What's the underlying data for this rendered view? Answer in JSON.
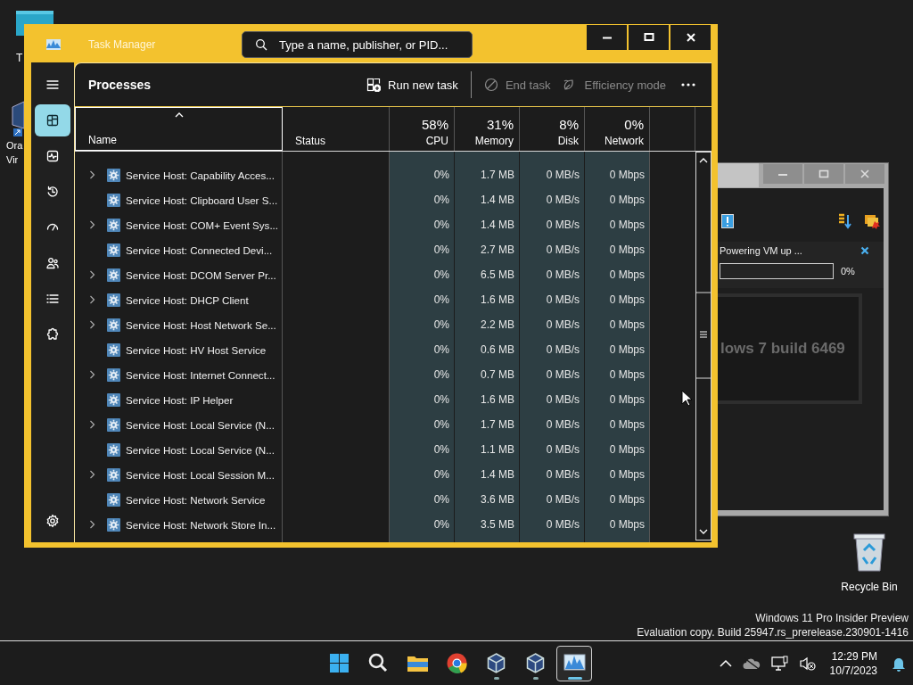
{
  "desktop_icons": [
    {
      "label_lines": [
        "T"
      ]
    },
    {
      "label_lines": [
        "Ora",
        "Vir"
      ]
    }
  ],
  "recycle_bin": {
    "label": "Recycle Bin"
  },
  "vbox_window": {
    "notice": "Powering VM up ...",
    "progress": {
      "level": 0,
      "reading": "0%"
    },
    "preview_text": "lows 7 build 6469"
  },
  "task_manager": {
    "title": "Task Manager",
    "search": {
      "placeholder": "Type a name, publisher, or PID..."
    },
    "nav": [
      {
        "kind": "menu",
        "selected": false
      },
      {
        "kind": "processes",
        "selected": true
      },
      {
        "kind": "performance",
        "selected": false
      },
      {
        "kind": "history",
        "selected": false
      },
      {
        "kind": "startup",
        "selected": false
      },
      {
        "kind": "users",
        "selected": false
      },
      {
        "kind": "details",
        "selected": false
      },
      {
        "kind": "services",
        "selected": false
      },
      {
        "kind": "settings",
        "selected": false
      }
    ],
    "page_title": "Processes",
    "toolbar": [
      {
        "kind": "run",
        "label": "Run new task",
        "disabled": false
      },
      {
        "kind": "end",
        "label": "End task",
        "disabled": true
      },
      {
        "kind": "efficiency",
        "label": "Efficiency mode",
        "disabled": true
      }
    ],
    "columns": [
      {
        "label": "Name",
        "sorted": true
      },
      {
        "label": "Status",
        "sorted": false
      },
      {
        "percent": "58%",
        "label": "CPU",
        "sorted": false
      },
      {
        "percent": "31%",
        "label": "Memory",
        "sorted": false
      },
      {
        "percent": "8%",
        "label": "Disk",
        "sorted": false
      },
      {
        "percent": "0%",
        "label": "Network",
        "sorted": false
      }
    ],
    "rows": [
      {
        "name": "Service Host: Capability Acces...",
        "expandable": true,
        "cpu": "0%",
        "memory": "1.7 MB",
        "disk": "0 MB/s",
        "network": "0 Mbps"
      },
      {
        "name": "Service Host: Clipboard User S...",
        "expandable": false,
        "cpu": "0%",
        "memory": "1.4 MB",
        "disk": "0 MB/s",
        "network": "0 Mbps"
      },
      {
        "name": "Service Host: COM+ Event Sys...",
        "expandable": true,
        "cpu": "0%",
        "memory": "1.4 MB",
        "disk": "0 MB/s",
        "network": "0 Mbps"
      },
      {
        "name": "Service Host: Connected Devi...",
        "expandable": false,
        "cpu": "0%",
        "memory": "2.7 MB",
        "disk": "0 MB/s",
        "network": "0 Mbps"
      },
      {
        "name": "Service Host: DCOM Server Pr...",
        "expandable": true,
        "cpu": "0%",
        "memory": "6.5 MB",
        "disk": "0 MB/s",
        "network": "0 Mbps"
      },
      {
        "name": "Service Host: DHCP Client",
        "expandable": true,
        "cpu": "0%",
        "memory": "1.6 MB",
        "disk": "0 MB/s",
        "network": "0 Mbps"
      },
      {
        "name": "Service Host: Host Network Se...",
        "expandable": true,
        "cpu": "0%",
        "memory": "2.2 MB",
        "disk": "0 MB/s",
        "network": "0 Mbps"
      },
      {
        "name": "Service Host: HV Host Service",
        "expandable": false,
        "cpu": "0%",
        "memory": "0.6 MB",
        "disk": "0 MB/s",
        "network": "0 Mbps"
      },
      {
        "name": "Service Host: Internet Connect...",
        "expandable": true,
        "cpu": "0%",
        "memory": "0.7 MB",
        "disk": "0 MB/s",
        "network": "0 Mbps"
      },
      {
        "name": "Service Host: IP Helper",
        "expandable": false,
        "cpu": "0%",
        "memory": "1.6 MB",
        "disk": "0 MB/s",
        "network": "0 Mbps"
      },
      {
        "name": "Service Host: Local Service (N...",
        "expandable": true,
        "cpu": "0%",
        "memory": "1.7 MB",
        "disk": "0 MB/s",
        "network": "0 Mbps"
      },
      {
        "name": "Service Host: Local Service (N...",
        "expandable": false,
        "cpu": "0%",
        "memory": "1.1 MB",
        "disk": "0 MB/s",
        "network": "0 Mbps"
      },
      {
        "name": "Service Host: Local Session M...",
        "expandable": true,
        "cpu": "0%",
        "memory": "1.4 MB",
        "disk": "0 MB/s",
        "network": "0 Mbps"
      },
      {
        "name": "Service Host: Network Service",
        "expandable": false,
        "cpu": "0%",
        "memory": "3.6 MB",
        "disk": "0 MB/s",
        "network": "0 Mbps"
      },
      {
        "name": "Service Host: Network Store In...",
        "expandable": true,
        "cpu": "0%",
        "memory": "3.5 MB",
        "disk": "0 MB/s",
        "network": "0 Mbps"
      }
    ]
  },
  "edition_notice": [
    "Windows 11 Pro Insider Preview",
    "Evaluation copy. Build 25947.rs_prerelease.230901-1416"
  ],
  "taskbar": {
    "apps": [
      {
        "kind": "start",
        "running": false,
        "active": false
      },
      {
        "kind": "search",
        "running": false,
        "active": false
      },
      {
        "kind": "folder",
        "running": false,
        "active": false
      },
      {
        "kind": "browser",
        "running": false,
        "active": false
      },
      {
        "kind": "cube",
        "running": true,
        "active": false
      },
      {
        "kind": "cube",
        "running": true,
        "active": false
      },
      {
        "kind": "monitor",
        "running": true,
        "active": true
      }
    ],
    "clock": {
      "time": "12:29 PM",
      "date": "10/7/2023"
    }
  }
}
